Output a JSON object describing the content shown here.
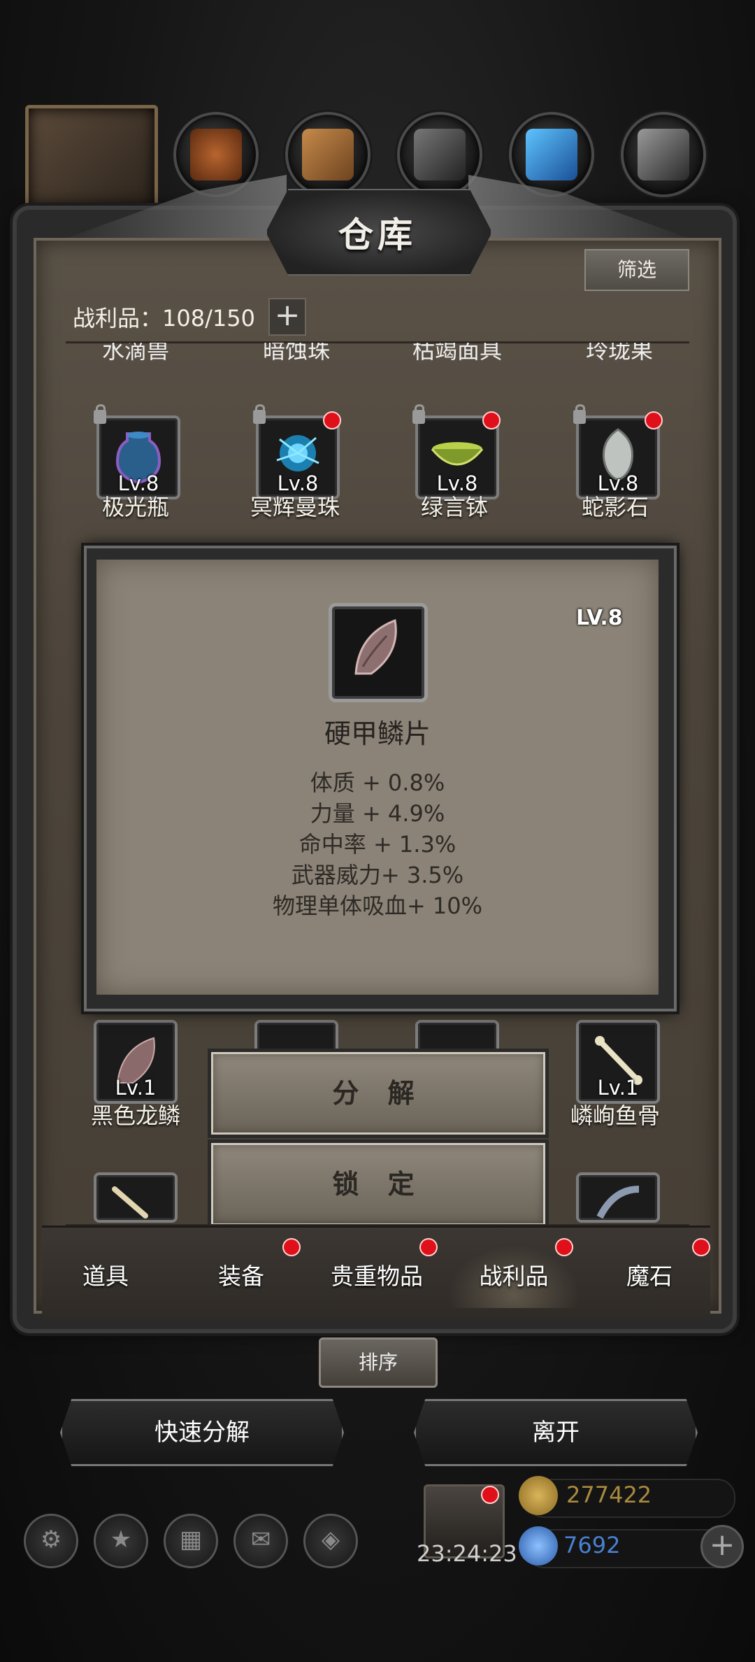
{
  "window": {
    "title": "仓库"
  },
  "filter_button": "筛选",
  "inventory": {
    "category": "战利品",
    "count": "108/150",
    "label": "战利品：108/150"
  },
  "cut_row": [
    "水滴兽",
    "暗蚀珠",
    "枯竭面具",
    "玲珑果"
  ],
  "row1": [
    {
      "level": "Lv.8",
      "name": "极光瓶",
      "icon": "purple-vase",
      "locked": true,
      "new": false
    },
    {
      "level": "Lv.8",
      "name": "冥辉曼珠",
      "icon": "blue-flower",
      "locked": true,
      "new": true
    },
    {
      "level": "Lv.8",
      "name": "绿言钵",
      "icon": "green-bowl",
      "locked": true,
      "new": true
    },
    {
      "level": "Lv.8",
      "name": "蛇影石",
      "icon": "snake-stone",
      "locked": true,
      "new": true
    }
  ],
  "detail": {
    "name": "硬甲鳞片",
    "level": "LV.8",
    "icon": "scale-icon",
    "stats": [
      "体质 + 0.8%",
      "力量 + 4.9%",
      "命中率 + 1.3%",
      "武器威力+ 3.5%",
      "物理单体吸血+ 10%"
    ],
    "actions": {
      "decompose": "分 解",
      "lock": "锁 定"
    }
  },
  "row3": [
    {
      "level": "Lv.1",
      "name": "黑色龙鳞",
      "icon": "dragon-scale"
    },
    {
      "level": "Lv.1",
      "name": "嶙峋鱼骨",
      "icon": "fish-bone"
    }
  ],
  "tabs": [
    {
      "label": "道具",
      "badge": false
    },
    {
      "label": "装备",
      "badge": true
    },
    {
      "label": "贵重物品",
      "badge": true
    },
    {
      "label": "战利品",
      "badge": true,
      "active": true
    },
    {
      "label": "魔石",
      "badge": true
    }
  ],
  "sort_button": "排序",
  "bottom_buttons": {
    "quick_decompose": "快速分解",
    "leave": "离开"
  },
  "status": {
    "timer": "23:24:23",
    "gold": "277422",
    "gems": "7692"
  },
  "colors": {
    "badge": "#e0101a",
    "gold": "#a98a3f",
    "gem": "#4a7fd0"
  }
}
